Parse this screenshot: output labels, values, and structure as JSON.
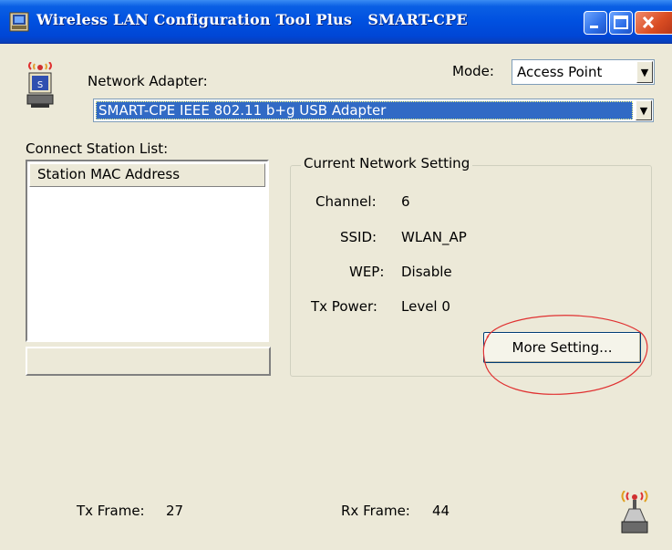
{
  "window": {
    "title": "Wireless LAN Configuration Tool Plus   SMART-CPE"
  },
  "adapter": {
    "label": "Network Adapter:",
    "selected": "SMART-CPE IEEE 802.11 b+g USB Adapter"
  },
  "mode": {
    "label": "Mode:",
    "selected": "Access Point"
  },
  "station_list": {
    "label": "Connect Station List:",
    "column_header": "Station MAC Address",
    "rows": []
  },
  "network_setting": {
    "title": "Current Network Setting",
    "channel_label": "Channel:",
    "channel_value": "6",
    "ssid_label": "SSID:",
    "ssid_value": "WLAN_AP",
    "wep_label": "WEP:",
    "wep_value": "Disable",
    "txpower_label": "Tx Power:",
    "txpower_value": "Level 0",
    "more_button": "More Setting..."
  },
  "stats": {
    "tx_label": "Tx Frame:",
    "tx_value": "27",
    "rx_label": "Rx Frame:",
    "rx_value": "44"
  },
  "icons": {
    "app": "wireless-adapter-icon",
    "corner": "antenna-icon"
  },
  "colors": {
    "title_bar": "#0050e0",
    "window_bg": "#ece9d8",
    "selection": "#316ac5",
    "highlight_circle": "#e03030"
  }
}
